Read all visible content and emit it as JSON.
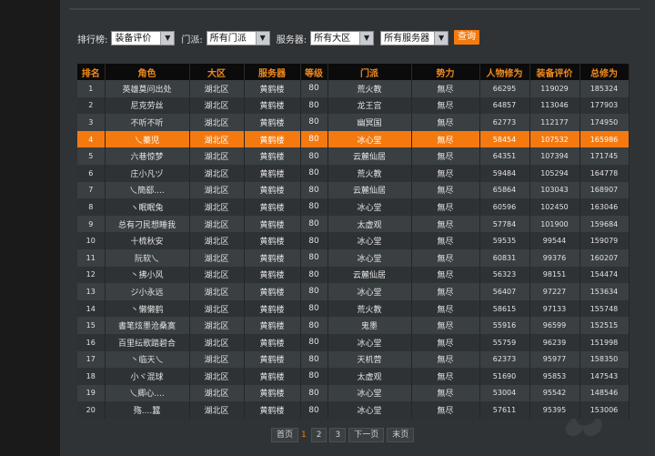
{
  "filters": {
    "rank_label": "排行榜:",
    "rank_value": "装备评价",
    "sect_label": "门派:",
    "sect_value": "所有门派",
    "server_label": "服务器:",
    "region_value": "所有大区",
    "server_value": "所有服务器",
    "query_label": "查询"
  },
  "table": {
    "headers": [
      "排名",
      "角色",
      "大区",
      "服务器",
      "等级",
      "门派",
      "势力",
      "人物修为",
      "装备评价",
      "总修为"
    ],
    "rows": [
      [
        "1",
        "英雄莫问出处",
        "湖北区",
        "黄鹤楼",
        "80",
        "荒火教",
        "無尽",
        "66295",
        "119029",
        "185324"
      ],
      [
        "2",
        "尼克劳丝",
        "湖北区",
        "黄鹤楼",
        "80",
        "龙王宫",
        "無尽",
        "64857",
        "113046",
        "177903"
      ],
      [
        "3",
        "不听不听",
        "湖北区",
        "黄鹤楼",
        "80",
        "幽冥国",
        "無尽",
        "62773",
        "112177",
        "174950"
      ],
      [
        "4",
        "乀蓁児",
        "湖北区",
        "黄鹤楼",
        "80",
        "冰心堂",
        "無尽",
        "58454",
        "107532",
        "165986"
      ],
      [
        "5",
        "六巷惊梦",
        "湖北区",
        "黄鹤楼",
        "80",
        "云麓仙居",
        "無尽",
        "64351",
        "107394",
        "171745"
      ],
      [
        "6",
        "庄小凡ヅ",
        "湖北区",
        "黄鹤楼",
        "80",
        "荒火教",
        "無尽",
        "59484",
        "105294",
        "164778"
      ],
      [
        "7",
        "乀簡郄....",
        "湖北区",
        "黄鹤楼",
        "80",
        "云麓仙居",
        "無尽",
        "65864",
        "103043",
        "168907"
      ],
      [
        "8",
        "ヽ眠眠兔",
        "湖北区",
        "黄鹤楼",
        "80",
        "冰心堂",
        "無尽",
        "60596",
        "102450",
        "163046"
      ],
      [
        "9",
        "总有刁民想睡我",
        "湖北区",
        "黄鹤楼",
        "80",
        "太虚观",
        "無尽",
        "57784",
        "101900",
        "159684"
      ],
      [
        "10",
        "十梳秋安",
        "湖北区",
        "黄鹤楼",
        "80",
        "冰心堂",
        "無尽",
        "59535",
        "99544",
        "159079"
      ],
      [
        "11",
        "阮软乀",
        "湖北区",
        "黄鹤楼",
        "80",
        "冰心堂",
        "無尽",
        "60831",
        "99376",
        "160207"
      ],
      [
        "12",
        "丶拂小风",
        "湖北区",
        "黄鹤楼",
        "80",
        "云麓仙居",
        "無尽",
        "56323",
        "98151",
        "154474"
      ],
      [
        "13",
        "ジ小永远",
        "湖北区",
        "黄鹤楼",
        "80",
        "冰心堂",
        "無尽",
        "56407",
        "97227",
        "153634"
      ],
      [
        "14",
        "丶懒懒鹤",
        "湖北区",
        "黄鹤楼",
        "80",
        "荒火教",
        "無尽",
        "58615",
        "97133",
        "155748"
      ],
      [
        "15",
        "書笔炫墨沧桑寞",
        "湖北区",
        "黄鹤楼",
        "80",
        "鬼墨",
        "無尽",
        "55916",
        "96599",
        "152515"
      ],
      [
        "16",
        "百里纭歌踏碧合",
        "湖北区",
        "黄鹤楼",
        "80",
        "冰心堂",
        "無尽",
        "55759",
        "96239",
        "151998"
      ],
      [
        "17",
        "丶临天乀",
        "湖北区",
        "黄鹤楼",
        "80",
        "天机营",
        "無尽",
        "62373",
        "95977",
        "158350"
      ],
      [
        "18",
        "小ヾ混球",
        "湖北区",
        "黄鹤楼",
        "80",
        "太虚观",
        "無尽",
        "51690",
        "95853",
        "147543"
      ],
      [
        "19",
        "乀卿心....",
        "湖北区",
        "黄鹤楼",
        "80",
        "冰心堂",
        "無尽",
        "53004",
        "95542",
        "148546"
      ],
      [
        "20",
        "殇....蠶",
        "湖北区",
        "黄鹤楼",
        "80",
        "冰心堂",
        "無尽",
        "57611",
        "95395",
        "153006"
      ]
    ]
  },
  "pagination": {
    "first": "首页",
    "pages": [
      "1",
      "2",
      "3"
    ],
    "next": "下一页",
    "last": "末页"
  }
}
